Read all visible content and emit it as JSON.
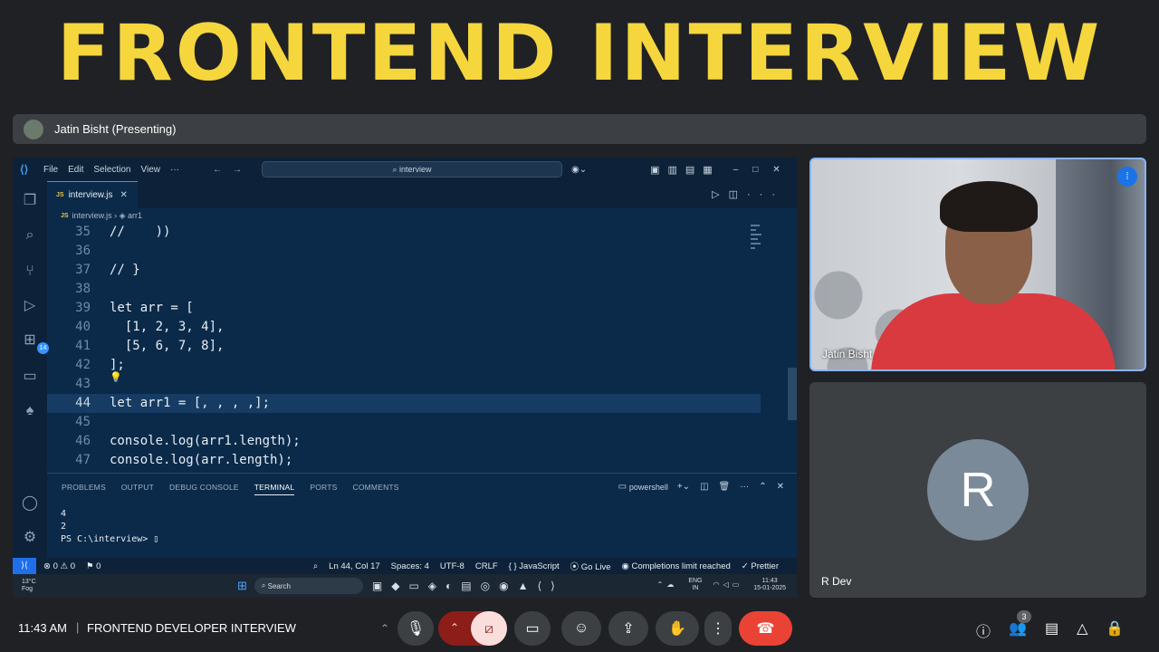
{
  "headline": "FRONTEND INTERVIEW",
  "presenter_bar": {
    "text": "Jatin Bisht (Presenting)"
  },
  "vscode": {
    "menu": [
      "File",
      "Edit",
      "Selection",
      "View",
      "···"
    ],
    "search_placeholder": "interview",
    "tab": {
      "icon": "JS",
      "name": "interview.js"
    },
    "breadcrumb": {
      "file": "interview.js",
      "symbol": "arr1"
    },
    "activity_badge": "14",
    "code_lines": [
      {
        "num": "35",
        "text": "//    ))"
      },
      {
        "num": "36",
        "text": ""
      },
      {
        "num": "37",
        "text": "// }"
      },
      {
        "num": "38",
        "text": ""
      },
      {
        "num": "39",
        "text": "let arr = ["
      },
      {
        "num": "40",
        "text": "  [1, 2, 3, 4],"
      },
      {
        "num": "41",
        "text": "  [5, 6, 7, 8],"
      },
      {
        "num": "42",
        "text": "];"
      },
      {
        "num": "43",
        "text": ""
      },
      {
        "num": "44",
        "text": "let arr1 = [, , , ,];"
      },
      {
        "num": "45",
        "text": ""
      },
      {
        "num": "46",
        "text": "console.log(arr1.length);"
      },
      {
        "num": "47",
        "text": "console.log(arr.length);"
      }
    ],
    "panel_tabs": [
      "PROBLEMS",
      "OUTPUT",
      "DEBUG CONSOLE",
      "TERMINAL",
      "PORTS",
      "COMMENTS"
    ],
    "active_panel_tab": "TERMINAL",
    "shell": "powershell",
    "terminal_lines": [
      "4",
      "2",
      "PS C:\\interview> "
    ],
    "status": {
      "errors": "0",
      "warnings": "0",
      "info": "0",
      "position": "Ln 44, Col 17",
      "spaces": "Spaces: 4",
      "encoding": "UTF-8",
      "eol": "CRLF",
      "language": "JavaScript",
      "golive": "Go Live",
      "completions": "Completions limit reached",
      "prettier": "Prettier"
    }
  },
  "taskbar": {
    "weather_temp": "13°C",
    "weather_desc": "Fog",
    "search": "Search",
    "lang_top": "ENG",
    "lang_bottom": "IN",
    "time": "11:43",
    "date": "15-01-2025"
  },
  "participants": {
    "cam_name": "Jatin Bisht",
    "r_initial": "R",
    "r_name": "R Dev"
  },
  "meet": {
    "time": "11:43 AM",
    "separator": "|",
    "meeting_name": "FRONTEND DEVELOPER INTERVIEW",
    "people_count": "3"
  }
}
